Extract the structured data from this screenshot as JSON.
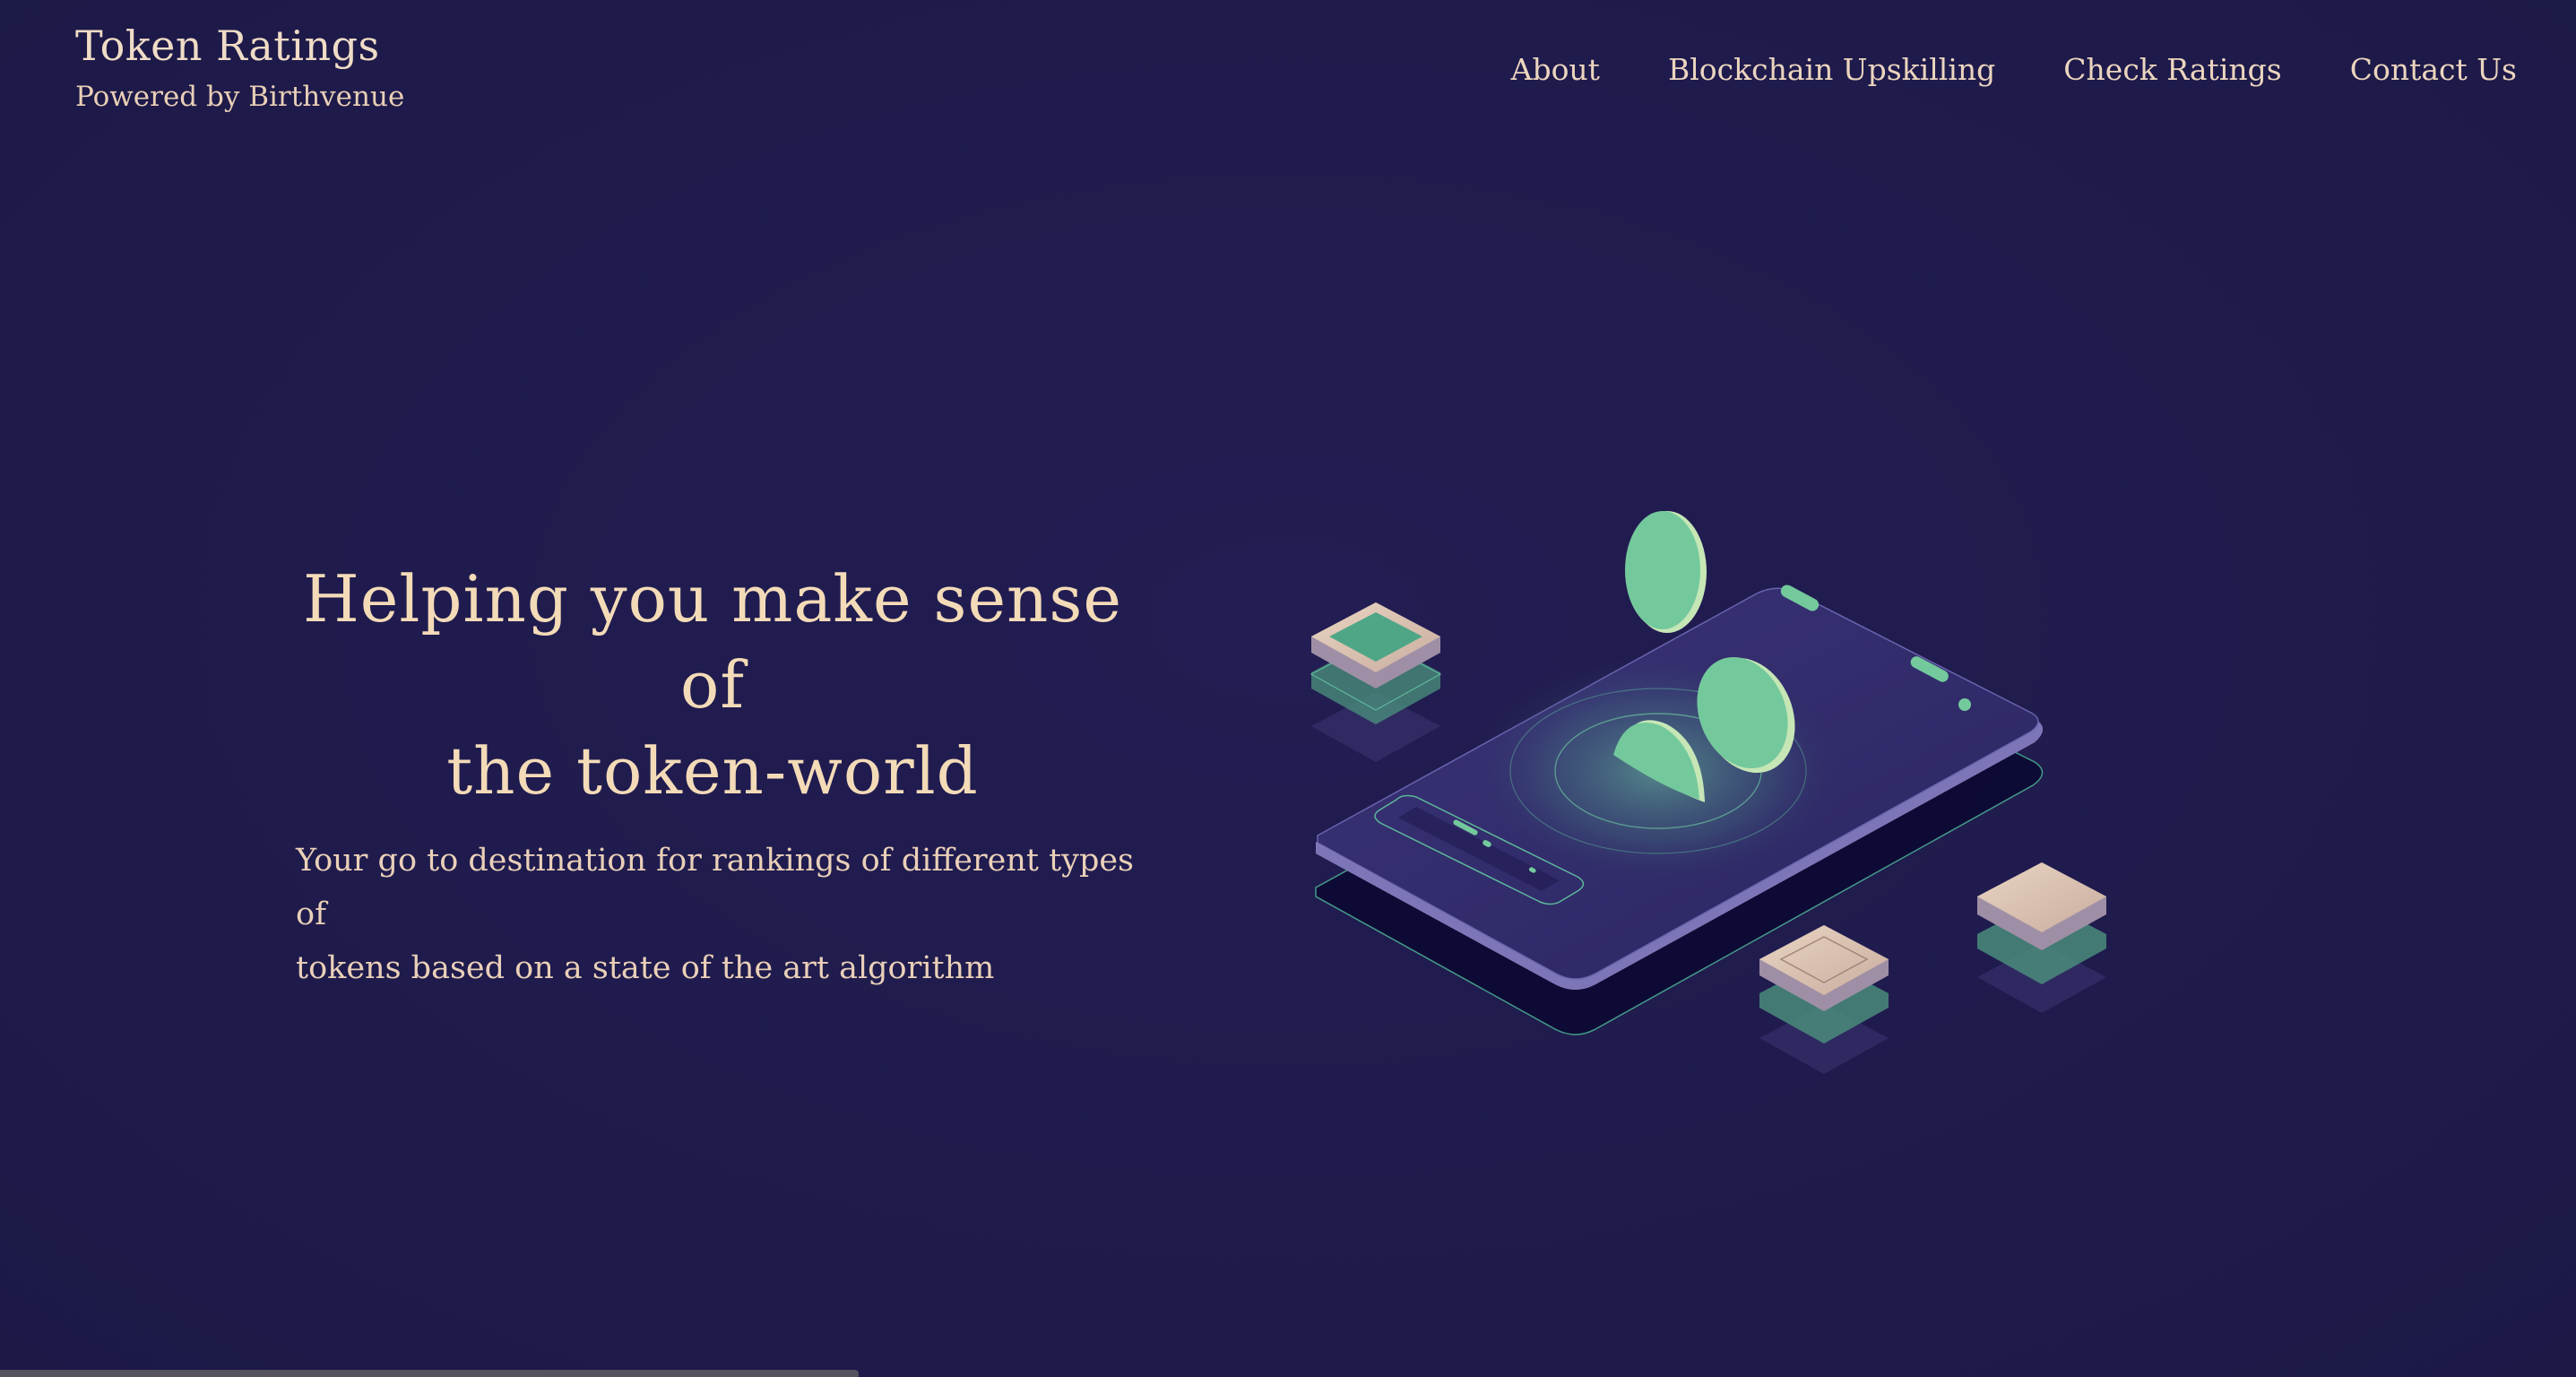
{
  "brand": {
    "title": "Token Ratings",
    "subtitle": "Powered by Birthvenue"
  },
  "nav": {
    "items": [
      {
        "label": "About"
      },
      {
        "label": "Blockchain Upskilling"
      },
      {
        "label": "Check Ratings"
      },
      {
        "label": "Contact Us"
      }
    ]
  },
  "hero": {
    "title_line1": "Helping you make sense of",
    "title_line2": "the token-world",
    "desc_line1": "Your go to destination for rankings of different types of",
    "desc_line2": "tokens based on a state of the art algorithm"
  },
  "illustration": {
    "icon": "isometric-phone-with-coins-illustration"
  },
  "colors": {
    "background": "#211c4e",
    "heading": "#f4dbb8",
    "text": "#ead0b8",
    "accent_green": "#74c99c",
    "accent_cream": "#e2c7b3"
  }
}
